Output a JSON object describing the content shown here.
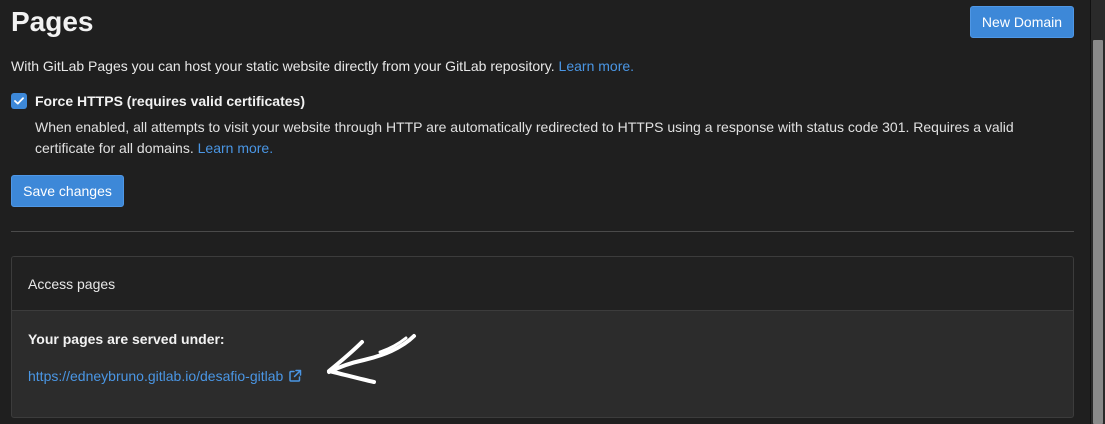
{
  "header": {
    "title": "Pages",
    "new_domain_label": "New Domain"
  },
  "intro": {
    "text": "With GitLab Pages you can host your static website directly from your GitLab repository.",
    "learn_more": "Learn more."
  },
  "force_https": {
    "checked": true,
    "label": "Force HTTPS (requires valid certificates)",
    "help_text": "When enabled, all attempts to visit your website through HTTP are automatically redirected to HTTPS using a response with status code 301. Requires a valid certificate for all domains.",
    "learn_more": "Learn more."
  },
  "save_label": "Save changes",
  "access_card": {
    "title": "Access pages",
    "served_label": "Your pages are served under:",
    "url": "https://edneybruno.gitlab.io/desafio-gitlab",
    "link_icon": "external-link-icon"
  },
  "colors": {
    "accent": "#3d88d8",
    "link": "#4a96e4",
    "background": "#1f1f1f"
  }
}
